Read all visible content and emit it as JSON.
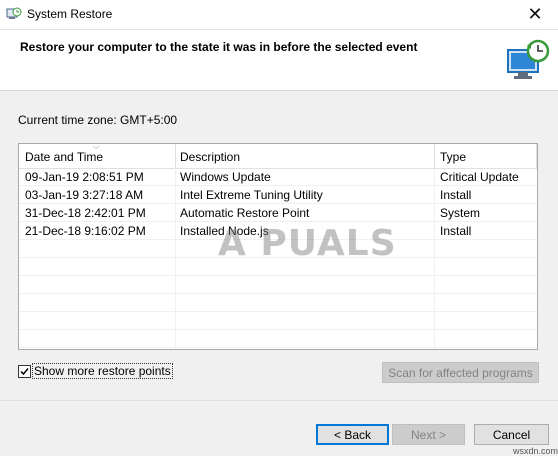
{
  "window": {
    "title": "System Restore",
    "close_glyph": "✕"
  },
  "header": {
    "heading": "Restore your computer to the state it was in before the selected event"
  },
  "timezone": "Current time zone: GMT+5:00",
  "list": {
    "columns": [
      "Date and Time",
      "Description",
      "Type"
    ],
    "rows": [
      {
        "date": "09-Jan-19 2:08:51 PM",
        "description": "Windows Update",
        "type": "Critical Update"
      },
      {
        "date": "03-Jan-19 3:27:18 AM",
        "description": "Intel Extreme Tuning Utility",
        "type": "Install"
      },
      {
        "date": "31-Dec-18 2:42:01 PM",
        "description": "Automatic Restore Point",
        "type": "System"
      },
      {
        "date": "21-Dec-18 9:16:02 PM",
        "description": "Installed Node.js",
        "type": "Install"
      }
    ]
  },
  "watermark": "A PUALS",
  "checkbox": {
    "label": "Show more restore points",
    "checked": true
  },
  "buttons": {
    "scan": "Scan for affected programs",
    "back": "< Back",
    "next": "Next >",
    "cancel": "Cancel"
  },
  "corner_text": "wsxdn.com",
  "colors": {
    "accent": "#0078d7",
    "icon_green": "#3a9a3a",
    "icon_blue": "#1e73be"
  }
}
